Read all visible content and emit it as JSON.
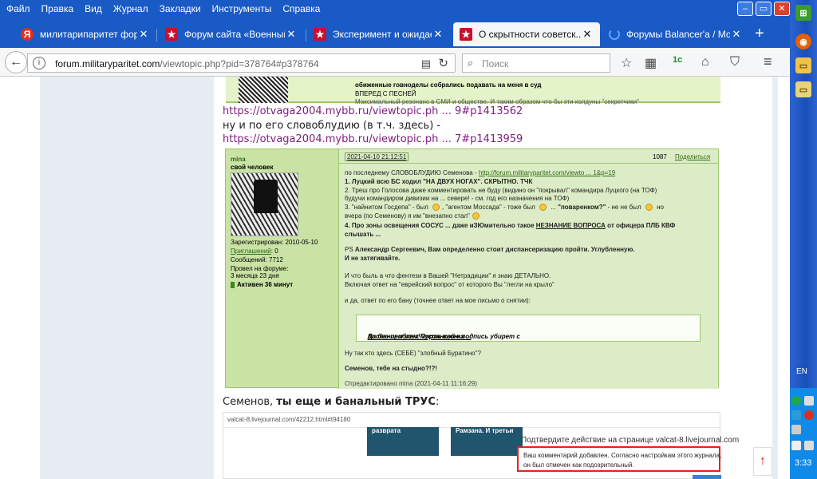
{
  "menubar": {
    "items": [
      "Файл",
      "Правка",
      "Вид",
      "Журнал",
      "Закладки",
      "Инструменты",
      "Справка"
    ],
    "minimize": "–",
    "maximize": "▭",
    "close": "✕"
  },
  "tabs": [
    {
      "label": "милитарипаритет фор...",
      "icon": "yandex-icon",
      "glyph": "Я",
      "active": false
    },
    {
      "label": "Форум сайта «Военный...",
      "icon": "star-icon",
      "glyph": "★",
      "active": false
    },
    {
      "label": "Эксперимент и ожидае...",
      "icon": "star-icon",
      "glyph": "★",
      "active": false
    },
    {
      "label": "О скрытности советск...",
      "icon": "star-icon",
      "glyph": "★",
      "active": true
    },
    {
      "label": "Форумы Balancer'a / Мо...",
      "icon": "loading-icon",
      "glyph": "",
      "active": false
    }
  ],
  "tab_close": "✕",
  "newtab": "+",
  "nav": {
    "url_domain": "forum.militaryparitet.com",
    "url_path": "/viewtopic.php?pid=378764#p378764",
    "search_placeholder": "Поиск",
    "back": "←",
    "reload": "↻"
  },
  "topframe": {
    "line1": "обиженные говноделы собрались подавать на меня в суд",
    "line2": "ВПЕРЕД С ПЕСНЕЙ",
    "line3": "Максимальный резонанс в СМИ и обществе. И таким образом что бы эти колдуны \"секретчики\""
  },
  "body": {
    "link1": "https://otvaga2004.mybb.ru/viewtopic.ph ... 9#p1413562",
    "text1": "ну и по его словоблудию (в т.ч. здесь) -",
    "link2": "https://otvaga2004.mybb.ru/viewtopic.ph ... 7#p1413959",
    "sem_prefix": "Семенов, ",
    "sem_bold": "ты еще и банальный ТРУС",
    "sem_suffix": ":"
  },
  "post": {
    "user": {
      "name": "mina",
      "title": "свой человек",
      "registered": "Зарегистрирован: 2010-05-10",
      "invites_label": "Приглашений",
      "invites_rest": ": 0",
      "posts": "Сообщений: 7712",
      "time_label": "Провел на форуме:",
      "time_value": "3 месяца 23 дня",
      "active": "Активен 36 минут"
    },
    "time": "2021-04-10 21:12:51",
    "number": "1087",
    "share": "Поделиться",
    "l1a": "по последнему СЛОВОБЛУДИЮ Семенова - ",
    "l1b": "http://forum.militaryparitet.com/viewto ... 1&p=19",
    "l2": "1. Луцкий всю БС ходил \"НА ДВУХ НОГАХ\". СКРЫТНО. ТЧК",
    "l3": "2. Треш про Голосова даже комментировать не буду (видино он \"покрывал\" командира Луцкого (на ТОФ)",
    "l4": "будучи командиром дивизии на ... севере! - см. год его назначения на ТОФ)",
    "l5a": "3. \"найнитом Госдепа\" - был ",
    "l5b": ", \"агентом Моссада\" - тоже был ",
    "l5c": " ... ",
    "l5d": "\"поваренком?\"",
    "l5e": " - не не был ",
    "l5f": " но",
    "l6": "вчера (по Семенову) я им \"внезапно стал\"",
    "l7a": "4. Про зоны освещения СОСУС ... даже иЗЮмительно такое ",
    "l7b": "НЕЗНАНИЕ ВОПРОСА",
    "l7c": " от офицера ПЛБ КВФ",
    "l8": "слышать ...",
    "l9a": "PS ",
    "l9b": "Александр Сергеевич, Вам определенно стоит диспансеризацию пройти. Углубленную.",
    "l10": "И не затягивайте.",
    "l11": "И что быль а что фентези в Вашей \"Нетрадиции\" я знаю ДЕТАЛЬНО.",
    "l12": "Включая ответ на \"еврейский вопрос\" от которого Вы \"легли на крыло\"",
    "l13": "и да, ответ по его бану (точнее ответ на мое письмо о снятии):",
    "quote_a": "Да без проблем!Пусть свою подпись убирет с ",
    "quote_b": "посланием всех морзянкой на ...",
    "quote_c": "!",
    "l14": "Ну так кто здесь (СЕБЕ) \"злобный Буратино\"?",
    "l15": "Семенов, тебе на стыдно?!?!",
    "l16": "Отредактировано mina (2021-04-11 11:16:29)"
  },
  "screenshot": {
    "url": "valcat-8.livejournal.com/42212.html#t94180",
    "tile1": "разврата",
    "tile2": "Рамзана. И третьи",
    "dialog_title": "Подтвердите действие на странице valcat-8.livejournal.com",
    "notice1": "Ваш комментарий добавлен. Согласно настройкам этого журнала,",
    "notice2": "он был отмечен как подозрительный."
  },
  "scroll_top": "↑",
  "taskbar": {
    "lang": "EN",
    "clock": "3:33"
  }
}
